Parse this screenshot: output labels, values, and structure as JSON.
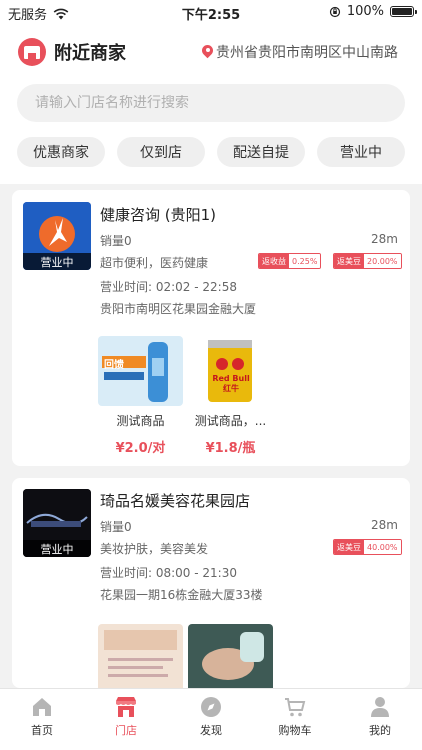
{
  "status_bar": {
    "carrier": "无服务",
    "time": "下午2:55",
    "battery": "100%"
  },
  "header": {
    "title": "附近商家",
    "location": "贵州省贵阳市南明区中山南路"
  },
  "search": {
    "placeholder": "请输入门店名称进行搜索"
  },
  "filters": [
    "优惠商家",
    "仅到店",
    "配送自提",
    "营业中"
  ],
  "stores": [
    {
      "name": "健康咨询 (贵阳1)",
      "status": "营业中",
      "sales": "销量0",
      "distance": "28m",
      "tags": "超市便利，医药健康",
      "hours": "营业时间: 02:02 - 22:58",
      "address": "贵阳市南明区花果园金融大厦",
      "badges": [
        {
          "label": "返收益",
          "value": "0.25%"
        },
        {
          "label": "返美豆",
          "value": "20.00%"
        }
      ],
      "products": [
        {
          "name": "测试商品",
          "price": "¥2.0/对",
          "image_text": "回馈"
        },
        {
          "name": "测试商品，...",
          "price": "¥1.8/瓶",
          "image_text": "Red Bull 红牛"
        }
      ]
    },
    {
      "name": "琦品名媛美容花果园店",
      "status": "营业中",
      "sales": "销量0",
      "distance": "28m",
      "tags": "美妆护肤，美容美发",
      "hours": "营业时间: 08:00 - 21:30",
      "address": "花果园一期16栋金融大厦33楼",
      "badges": [
        {
          "label": "返美豆",
          "value": "40.00%"
        }
      ]
    }
  ],
  "tabbar": [
    {
      "label": "首页",
      "icon": "home-icon"
    },
    {
      "label": "门店",
      "icon": "store-icon",
      "active": true
    },
    {
      "label": "发现",
      "icon": "compass-icon"
    },
    {
      "label": "购物车",
      "icon": "cart-icon"
    },
    {
      "label": "我的",
      "icon": "user-icon"
    }
  ],
  "colors": {
    "accent": "#e8505b",
    "page_bg": "#f2f2f2"
  }
}
